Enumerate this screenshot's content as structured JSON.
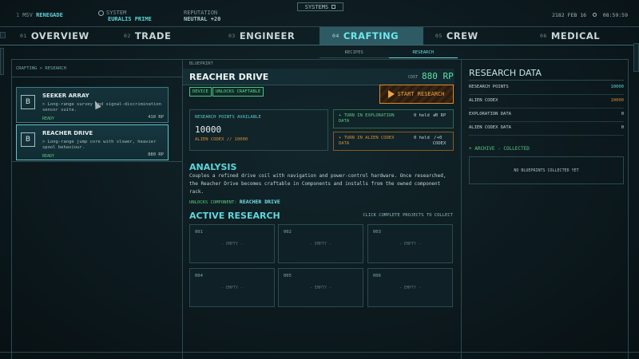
{
  "header": {
    "systems_label": "SYSTEMS",
    "ship": {
      "num": "1",
      "key": "MSV",
      "value": "RENEGADE"
    },
    "system": {
      "key": "SYSTEM",
      "value": "EURALIS PRIME"
    },
    "reputation": {
      "key": "REPUTATION",
      "value": "NEUTRAL +20"
    },
    "date": "2182 FEB 16",
    "time": "08:59:59"
  },
  "tabs": [
    {
      "num": "01",
      "label": "OVERVIEW"
    },
    {
      "num": "02",
      "label": "TRADE"
    },
    {
      "num": "03",
      "label": "ENGINEER"
    },
    {
      "num": "04",
      "label": "CRAFTING"
    },
    {
      "num": "05",
      "label": "CREW"
    },
    {
      "num": "06",
      "label": "MEDICAL"
    }
  ],
  "subtabs": [
    "RECIPES",
    "RESEARCH"
  ],
  "breadcrumb": "CRAFTING > RESEARCH",
  "blueprints": [
    {
      "badge": "B",
      "title": "SEEKER ARRAY",
      "desc": "> Long-range survey and signal-discrimination sensor suite.",
      "status": "READY",
      "rp": "410 RP"
    },
    {
      "badge": "B",
      "title": "REACHER DRIVE",
      "desc": "> Long-range jump core with slower, heavier spool behaviour.",
      "status": "READY",
      "rp": "880 RP"
    }
  ],
  "detail": {
    "section_label": "BLUEPRINT",
    "title": "REACHER DRIVE",
    "cost_label": "COST",
    "cost_value": "880 RP",
    "chips": [
      "DEVICE",
      "UNLOCKS CRAFTABLE"
    ],
    "start_label": "START RESEARCH",
    "rp_available_label": "RESEARCH POINTS AVAILABLE",
    "rp_available_value": "10000",
    "alien_codex_line": "ALIEN CODEX // 10000",
    "turn_in": [
      {
        "label": "+ TURN IN EXPLORATION DATA",
        "held": "0 held",
        "sep": "/",
        "gain": "+0 RP",
        "color": "#5ec97e"
      },
      {
        "label": "+ TURN IN ALIEN CODEX DATA",
        "held": "0 held",
        "sep": "/",
        "gain": "+0 CODEX",
        "color": "#d98c2f"
      }
    ],
    "analysis_title": "ANALYSIS",
    "analysis_text": "Couples a refined drive coil with navigation and power-control hardware. Once researched, the Reacher Drive becomes craftable in Components and installs from the owned component rack.",
    "unlocks_label": "UNLOCKS COMPONENT:",
    "unlocks_value": "REACHER DRIVE"
  },
  "active_research": {
    "title": "ACTIVE RESEARCH",
    "hint": "CLICK COMPLETE PROJECTS TO COLLECT",
    "slots": [
      {
        "id": "001",
        "state": "- EMPTY -"
      },
      {
        "id": "002",
        "state": "- EMPTY -"
      },
      {
        "id": "003",
        "state": "- EMPTY -"
      },
      {
        "id": "004",
        "state": "- EMPTY -"
      },
      {
        "id": "005",
        "state": "- EMPTY -"
      },
      {
        "id": "006",
        "state": "- EMPTY -"
      }
    ]
  },
  "research_data": {
    "title": "RESEARCH DATA",
    "rows": [
      {
        "label": "RESEARCH POINTS",
        "value": "10000",
        "color": "#5fd3d8"
      },
      {
        "label": "ALIEN CODEX",
        "value": "10000",
        "color": "#d98c2f"
      },
      {
        "label": "EXPLORATION DATA",
        "value": "0",
        "color": "#c5d3d5"
      },
      {
        "label": "ALIEN CODEX DATA",
        "value": "0",
        "color": "#c5d3d5"
      }
    ],
    "archive_label": "+ ARCHIVE - COLLECTED",
    "archive_empty": "NO BLUEPRINTS COLLECTED YET"
  }
}
